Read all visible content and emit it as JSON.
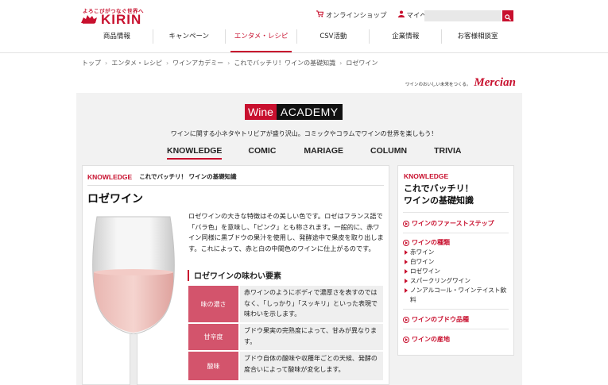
{
  "header": {
    "tagline": "よろこびがつなぐ世界へ",
    "brand": "KIRIN",
    "utility": {
      "shop": "オンラインショップ",
      "mypage": "マイページ"
    },
    "search": {
      "placeholder": ""
    }
  },
  "nav": {
    "items": [
      {
        "label": "商品情報"
      },
      {
        "label": "キャンペーン"
      },
      {
        "label": "エンタメ・レシピ"
      },
      {
        "label": "CSV活動"
      },
      {
        "label": "企業情報"
      },
      {
        "label": "お客様相談室"
      }
    ],
    "active_index": 2
  },
  "breadcrumb": [
    "トップ",
    "エンタメ・レシピ",
    "ワインアカデミー",
    "これでバッチリ！ワインの基礎知識",
    "ロゼワイン"
  ],
  "mercian": {
    "tag": "ワインのおいしい未来をつくる。",
    "logo": "Mercian"
  },
  "academy": {
    "title_part1": "Wine",
    "title_part2": "ACADEMY",
    "tagline": "ワインに関する小ネタやトリビアが盛り沢山。コミックやコラムでワインの世界を楽しもう！",
    "tabs": [
      {
        "label": "KNOWLEDGE"
      },
      {
        "label": "COMIC"
      },
      {
        "label": "MARIAGE"
      },
      {
        "label": "COLUMN"
      },
      {
        "label": "TRIVIA"
      }
    ],
    "active_tab": 0
  },
  "main": {
    "kw_label": "KNOWLEDGE",
    "kw_sub": "これでバッチリ！ ワインの基礎知識",
    "title": "ロゼワイン",
    "intro": "ロゼワインの大きな特徴はその美しい色です。ロゼはフランス語で「バラ色」を意味し、「ピンク」とも称されます。一般的に、赤ワイン同様に黒ブドウの果汁を使用し、発酵途中で果皮を取り出します。これによって、赤と白の中間色のワインに仕上がるのです。",
    "section_title": "ロゼワインの味わい要素",
    "taste": [
      {
        "label": "味の濃さ",
        "desc": "赤ワインのようにボディで濃厚さを表すのではなく、「しっかり」「スッキリ」といった表現で味わいを示します。"
      },
      {
        "label": "甘辛度",
        "desc": "ブドウ果実の完熟度によって、甘みが異なります。"
      },
      {
        "label": "酸味",
        "desc": "ブドウ自体の酸味や収穫年ごとの天候、発酵の度合いによって酸味が変化します。"
      }
    ]
  },
  "sidebar": {
    "kw_label": "KNOWLEDGE",
    "title_line1": "これでバッチリ！",
    "title_line2": "ワインの基礎知識",
    "links": {
      "first_step": "ワインのファーストステップ",
      "types": "ワインの種類",
      "grapes": "ワインのブドウ品種",
      "regions": "ワインの産地"
    },
    "types": [
      "赤ワイン",
      "白ワイン",
      "ロゼワイン",
      "スパークリングワイン",
      "ノンアルコール・ワインテイスト飲料"
    ]
  },
  "colors": {
    "brand_red": "#c8102e",
    "taste_label_bg": "#d3546c",
    "gray_band": "#f2f2f2"
  }
}
